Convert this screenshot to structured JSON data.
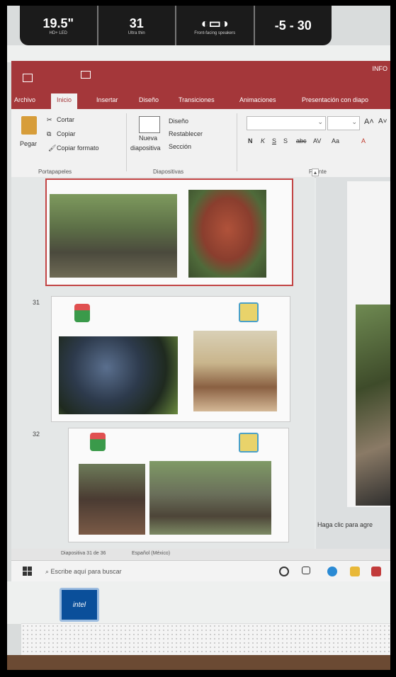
{
  "monitor_specs": [
    {
      "value": "19.5\"",
      "label": "HD+ LED"
    },
    {
      "value": "31",
      "label": "Ultra thin"
    },
    {
      "value": "",
      "label": "Front-facing speakers"
    },
    {
      "value": "-5 - 30",
      "label": ""
    }
  ],
  "window": {
    "title": "INFO"
  },
  "tabs": [
    "Archivo",
    "Inicio",
    "Insertar",
    "Diseño",
    "Transiciones",
    "Animaciones",
    "Presentación con diapo"
  ],
  "active_tab": "Inicio",
  "ribbon": {
    "paste": "Pegar",
    "cut": "Cortar",
    "copy": "Copiar",
    "format_painter": "Copiar formato",
    "clipboard_group": "Portapapeles",
    "new_slide_1": "Nueva",
    "new_slide_2": "diapositiva",
    "layout": "Diseño",
    "reset": "Restablecer",
    "section": "Sección",
    "slides_group": "Diapositivas",
    "font_group": "Fuente",
    "bold": "N",
    "italic": "K",
    "underline": "S",
    "strike": "S"
  },
  "slides": [
    {
      "number": "",
      "selected": true
    },
    {
      "number": "31",
      "selected": false
    },
    {
      "number": "32",
      "selected": false
    }
  ],
  "notes_placeholder": "Haga clic para agre",
  "status": {
    "slide_info": "Diapositiva 31 de 36",
    "language": "Español (México)"
  },
  "taskbar": {
    "search_placeholder": "Escribe aquí para buscar"
  },
  "intel_badge": "intel"
}
